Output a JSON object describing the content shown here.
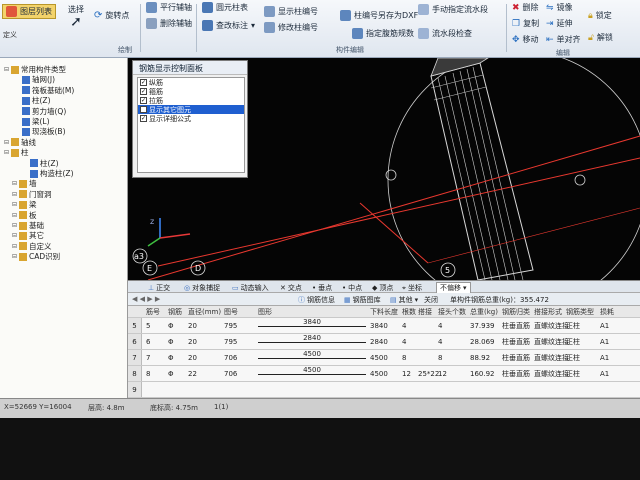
{
  "ribbon": {
    "file_list_label": "图层列表",
    "select_label": "选择",
    "define_label": "定义",
    "rotate_point_label": "旋转点",
    "draw_group_label": "绘制",
    "parallel_axis_label": "平行辅轴",
    "delete_axis_label": "删除辅轴",
    "circle_column_label": "圆元柱表",
    "check_mark_label": "查改标注",
    "show_column_num_label": "显示柱编号",
    "edit_column_num_label": "修改柱编号",
    "save_dxf_label": "柱编号另存为DXF",
    "specify_section_label": "指定腹筋规数",
    "manual_flow_label": "手动指定流水段",
    "flow_check_label": "流水段检查",
    "member_edit_group_label": "构件编辑",
    "delete_label": "删除",
    "copy_label": "复制",
    "move_label": "移动",
    "mirror_label": "镜像",
    "extend_label": "延伸",
    "align_label": "单对齐",
    "lock_label": "锁定",
    "unlock_label": "解锁",
    "edit_group_label": "编辑"
  },
  "tree": {
    "items": [
      {
        "label": "常用构件类型",
        "indent": 0,
        "icon_color": "#d9a530"
      },
      {
        "label": "轴网(J)",
        "indent": 2,
        "icon_color": "#3a6fc8"
      },
      {
        "label": "筏板基础(M)",
        "indent": 2,
        "icon_color": "#3a6fc8"
      },
      {
        "label": "柱(Z)",
        "indent": 2,
        "icon_color": "#3a6fc8"
      },
      {
        "label": "剪力墙(Q)",
        "indent": 2,
        "icon_color": "#3a6fc8"
      },
      {
        "label": "梁(L)",
        "indent": 2,
        "icon_color": "#3a6fc8"
      },
      {
        "label": "现浇板(B)",
        "indent": 2,
        "icon_color": "#3a6fc8"
      },
      {
        "label": "轴线",
        "indent": 0,
        "icon_color": "#d9a530"
      },
      {
        "label": "柱",
        "indent": 0,
        "icon_color": "#d9a530"
      },
      {
        "label": "柱(Z)",
        "indent": 3,
        "icon_color": "#3a6fc8"
      },
      {
        "label": "构造柱(Z)",
        "indent": 3,
        "icon_color": "#3a6fc8"
      },
      {
        "label": "墙",
        "indent": 1,
        "icon_color": "#d9a530"
      },
      {
        "label": "门窗洞",
        "indent": 1,
        "icon_color": "#d9a530"
      },
      {
        "label": "梁",
        "indent": 1,
        "icon_color": "#d9a530"
      },
      {
        "label": "板",
        "indent": 1,
        "icon_color": "#d9a530"
      },
      {
        "label": "基础",
        "indent": 1,
        "icon_color": "#d9a530"
      },
      {
        "label": "其它",
        "indent": 1,
        "icon_color": "#d9a530"
      },
      {
        "label": "自定义",
        "indent": 1,
        "icon_color": "#d9a530"
      },
      {
        "label": "CAD识别",
        "indent": 1,
        "icon_color": "#d9a530"
      }
    ]
  },
  "rebar_panel": {
    "title": "钢筋显示控制面板",
    "options": [
      {
        "label": "纵筋",
        "checked": true,
        "selected": false
      },
      {
        "label": "箍筋",
        "checked": true,
        "selected": false
      },
      {
        "label": "拉筋",
        "checked": true,
        "selected": false
      },
      {
        "label": "显示其它图元",
        "checked": false,
        "selected": true
      },
      {
        "label": "显示详细公式",
        "checked": true,
        "selected": false
      }
    ]
  },
  "viewport_labels": {
    "axis_a3": "a3",
    "axis_e": "E",
    "axis_d": "D",
    "axis_5": "5"
  },
  "toolbar2": {
    "orthogonal": "正交",
    "object_snap": "对象捕捉",
    "dynamic_input": "动态输入",
    "intersection": "交点",
    "endpoint": "垂点",
    "midpoint": "中点",
    "vertex": "顶点",
    "coordinate": "坐标",
    "no_offset": "不偏移"
  },
  "toolbar3": {
    "rebar_info": "钢筋信息",
    "rebar_diagram": "钢筋图库",
    "other": "其他",
    "close": "关闭",
    "total_weight": "单构件钢筋总重(kg)：355.472"
  },
  "grid": {
    "headers": [
      "筋号",
      "钢筋",
      "直径(mm)",
      "图号",
      "图形",
      "下料长度",
      "根数",
      "搭接",
      "接头个数",
      "总重(kg)",
      "钢筋归类",
      "搭接形式",
      "钢筋类型",
      "损耗"
    ],
    "rows": [
      {
        "row": "5",
        "num": "5",
        "grade": "Φ",
        "dia": "20",
        "fig": "795",
        "len_label": "3840",
        "cut": "3840",
        "count": "4",
        "lap": "",
        "joints": "4",
        "weight": "37.939",
        "cat": "柱垂直筋",
        "form": "直螺纹连接",
        "type": "正柱",
        "loss": "A1"
      },
      {
        "row": "6",
        "num": "6",
        "grade": "Φ",
        "dia": "20",
        "fig": "795",
        "len_label": "2840",
        "cut": "2840",
        "count": "4",
        "lap": "",
        "joints": "4",
        "weight": "28.069",
        "cat": "柱垂直筋",
        "form": "直螺纹连接",
        "type": "正柱",
        "loss": "A1"
      },
      {
        "row": "7",
        "num": "7",
        "grade": "Φ",
        "dia": "20",
        "fig": "706",
        "len_label": "4500",
        "cut": "4500",
        "count": "8",
        "lap": "",
        "joints": "8",
        "weight": "88.92",
        "cat": "柱垂直筋",
        "form": "直螺纹连接",
        "type": "正柱",
        "loss": "A1"
      },
      {
        "row": "8",
        "num": "8",
        "grade": "Φ",
        "dia": "22",
        "fig": "706",
        "len_label": "4500",
        "cut": "4500",
        "count": "12",
        "lap": "25*22",
        "joints": "12",
        "weight": "160.92",
        "cat": "柱垂直筋",
        "form": "直螺纹连接",
        "type": "正柱",
        "loss": "A1"
      },
      {
        "row": "9",
        "num": "",
        "grade": "",
        "dia": "",
        "fig": "",
        "len_label": "",
        "cut": "",
        "count": "",
        "lap": "",
        "joints": "",
        "weight": "",
        "cat": "",
        "form": "",
        "type": "",
        "loss": ""
      }
    ]
  },
  "status": {
    "coords": "X=52669 Y=16004",
    "floor_height": "层高: 4.8m",
    "base_height": "底标高: 4.75m",
    "scale": "1(1)"
  },
  "colors": {
    "ribbon_bg": "#e6ecf3",
    "viewport_bg": "#050505",
    "red_line": "#e8382f",
    "selection": "#1f5fd0"
  }
}
